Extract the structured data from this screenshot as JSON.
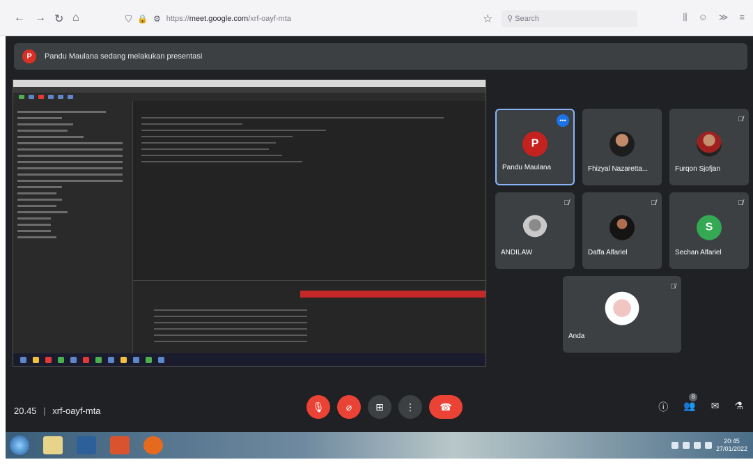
{
  "browser": {
    "url_prefix": "https://",
    "url_domain": "meet.google.com",
    "url_path": "/xrf-oayf-mta",
    "search_placeholder": "Search"
  },
  "banner": {
    "avatar_letter": "P",
    "text": "Pandu Maulana sedang melakukan presentasi"
  },
  "participants": [
    {
      "name": "Pandu Maulana",
      "avatar_letter": "P"
    },
    {
      "name": "Fhizyal Nazaretta..."
    },
    {
      "name": "Furqon Sjofjan"
    },
    {
      "name": "ANDILAW"
    },
    {
      "name": "Daffa Alfariel"
    },
    {
      "name": "Sechan Alfariel",
      "avatar_letter": "S"
    },
    {
      "name": "Anda"
    }
  ],
  "meeting": {
    "time": "20.45",
    "code": "xrf-oayf-mta",
    "people_count": "8"
  },
  "taskbar": {
    "clock_time": "20:45",
    "clock_date": "27/01/2022"
  }
}
